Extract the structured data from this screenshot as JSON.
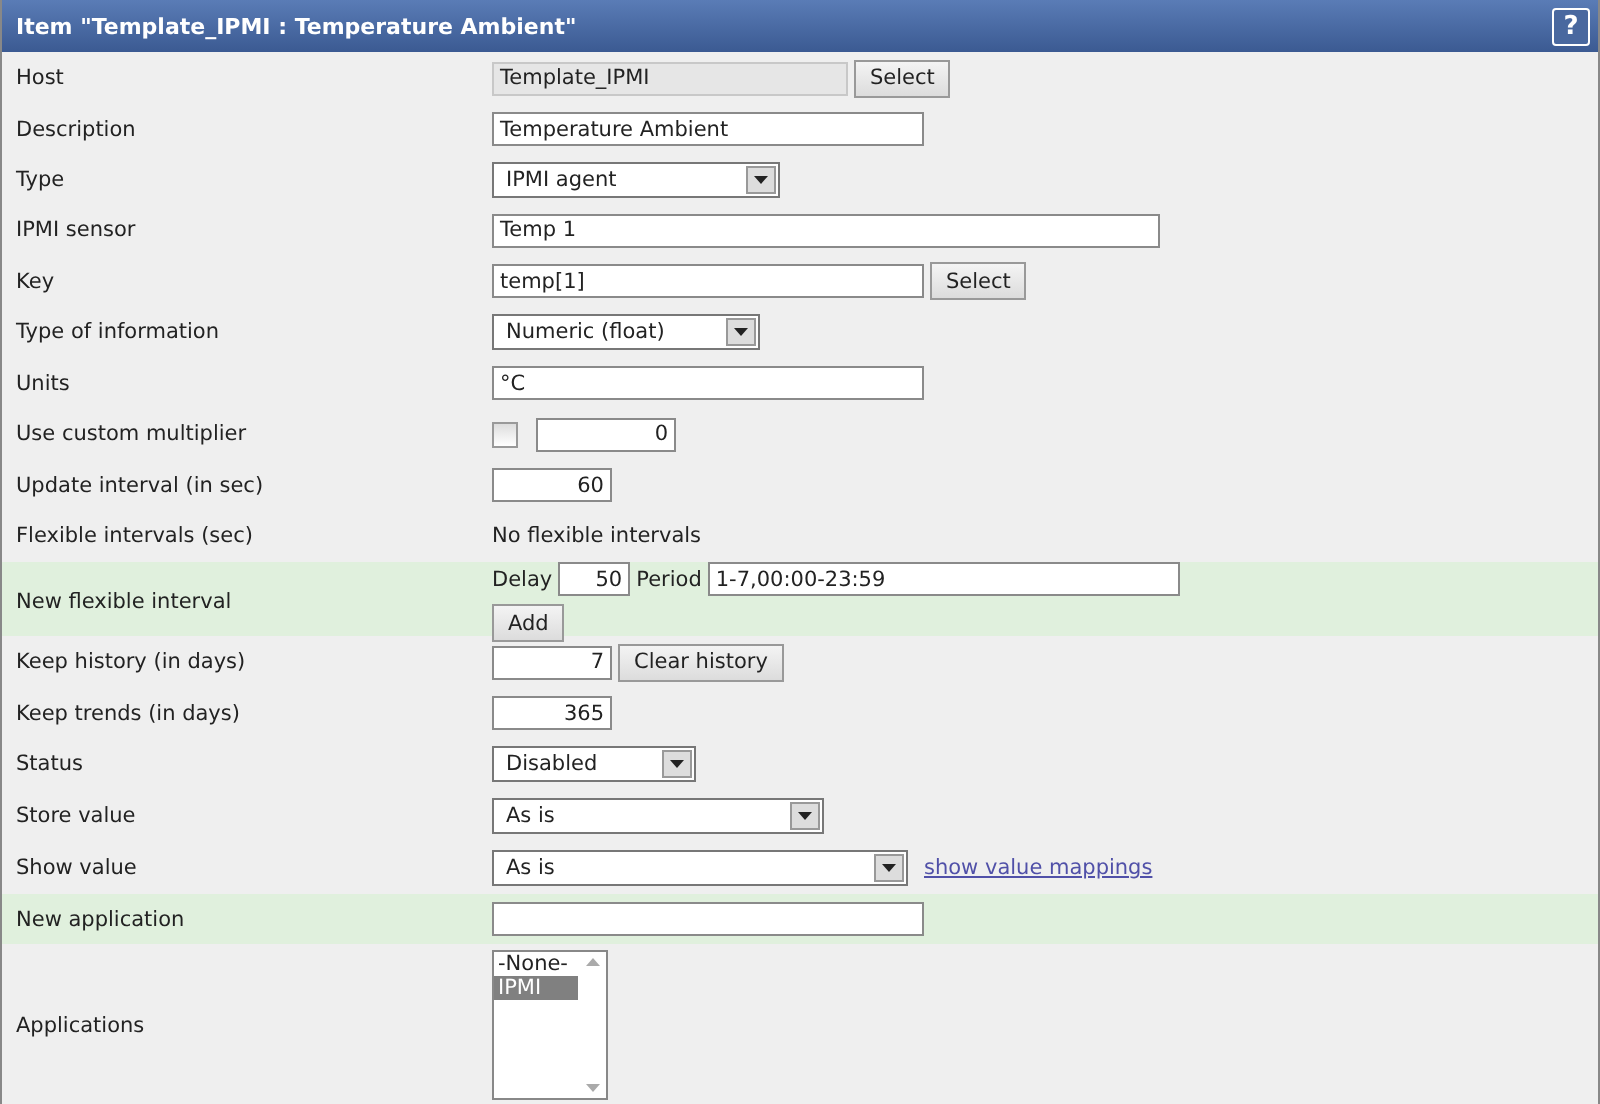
{
  "header": {
    "title": "Item \"Template_IPMI : Temperature Ambient\"",
    "help": "?"
  },
  "rows": [
    {
      "label": "Host",
      "highlighted": false,
      "controls": [
        {
          "kind": "readonly",
          "value": "Template_IPMI"
        },
        {
          "kind": "button",
          "text": "Select"
        }
      ]
    },
    {
      "label": "Description",
      "highlighted": false,
      "controls": [
        {
          "kind": "text",
          "value": "Temperature Ambient"
        }
      ]
    },
    {
      "label": "Type",
      "highlighted": false,
      "controls": [
        {
          "kind": "select",
          "value": "IPMI agent"
        }
      ]
    },
    {
      "label": "IPMI sensor",
      "highlighted": false,
      "controls": [
        {
          "kind": "text",
          "value": "Temp 1"
        }
      ]
    },
    {
      "label": "Key",
      "highlighted": false,
      "controls": [
        {
          "kind": "text",
          "value": "temp[1]"
        },
        {
          "kind": "button",
          "text": "Select"
        }
      ]
    },
    {
      "label": "Type of information",
      "highlighted": false,
      "controls": [
        {
          "kind": "select",
          "value": "Numeric (float)"
        }
      ]
    },
    {
      "label": "Units",
      "highlighted": false,
      "controls": [
        {
          "kind": "text",
          "value": "°C"
        }
      ]
    },
    {
      "label": "Use custom multiplier",
      "highlighted": false,
      "controls": [
        {
          "kind": "checkbox",
          "checked": false
        },
        {
          "kind": "number",
          "value": "0"
        }
      ]
    },
    {
      "label": "Update interval (in sec)",
      "highlighted": false,
      "controls": [
        {
          "kind": "number",
          "value": "60"
        }
      ]
    },
    {
      "label": "Flexible intervals (sec)",
      "highlighted": false,
      "controls": [
        {
          "kind": "label",
          "text": "No flexible intervals"
        }
      ]
    },
    {
      "label": "New flexible interval",
      "highlighted": true,
      "controls": [
        {
          "kind": "label",
          "text": "Delay"
        },
        {
          "kind": "number",
          "value": "50"
        },
        {
          "kind": "label",
          "text": "Period"
        },
        {
          "kind": "text",
          "value": "1-7,00:00-23:59"
        },
        {
          "kind": "break"
        },
        {
          "kind": "button",
          "text": "Add"
        }
      ]
    },
    {
      "label": "Keep history (in days)",
      "highlighted": false,
      "controls": [
        {
          "kind": "number",
          "value": "7"
        },
        {
          "kind": "button",
          "text": "Clear history"
        }
      ]
    },
    {
      "label": "Keep trends (in days)",
      "highlighted": false,
      "controls": [
        {
          "kind": "number",
          "value": "365"
        }
      ]
    },
    {
      "label": "Status",
      "highlighted": false,
      "controls": [
        {
          "kind": "select",
          "value": "Disabled"
        }
      ]
    },
    {
      "label": "Store value",
      "highlighted": false,
      "controls": [
        {
          "kind": "select",
          "value": "As is"
        }
      ]
    },
    {
      "label": "Show value",
      "highlighted": false,
      "controls": [
        {
          "kind": "select",
          "value": "As is"
        },
        {
          "kind": "link",
          "text": "show value mappings"
        }
      ]
    },
    {
      "label": "New application",
      "highlighted": true,
      "controls": [
        {
          "kind": "text"
        }
      ]
    },
    {
      "label": "Applications",
      "highlighted": false,
      "controls": [
        {
          "kind": "listbox",
          "options": [
            {
              "text": "-None-",
              "selected": false
            },
            {
              "text": "IPMI",
              "selected": true
            }
          ]
        }
      ]
    }
  ]
}
